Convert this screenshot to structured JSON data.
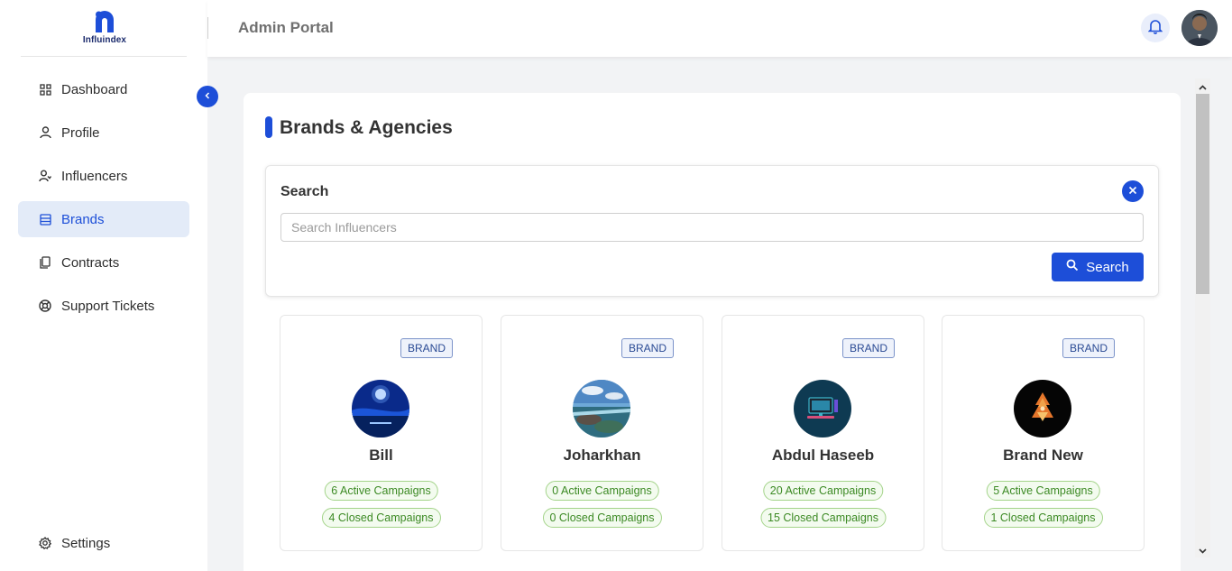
{
  "brand": {
    "logo_text": "Influindex"
  },
  "colors": {
    "accent": "#1d4ed8",
    "active_bg": "#e3ebf8",
    "pill_green": "#3c8a24"
  },
  "topbar": {
    "title": "Admin Portal",
    "bell_icon": "bell-icon"
  },
  "sidebar": {
    "items": [
      {
        "label": "Dashboard",
        "icon": "grid-icon"
      },
      {
        "label": "Profile",
        "icon": "user-icon"
      },
      {
        "label": "Influencers",
        "icon": "user-group-icon"
      },
      {
        "label": "Brands",
        "icon": "store-icon",
        "active": true
      },
      {
        "label": "Contracts",
        "icon": "document-icon"
      },
      {
        "label": "Support Tickets",
        "icon": "support-icon"
      }
    ],
    "settings": {
      "label": "Settings",
      "icon": "gear-icon"
    }
  },
  "page": {
    "heading": "Brands & Agencies"
  },
  "search": {
    "label": "Search",
    "placeholder": "Search Influencers",
    "value": "",
    "button_label": "Search"
  },
  "cards": [
    {
      "badge": "BRAND",
      "name": "Bill",
      "active": "6 Active Campaigns",
      "closed": "4 Closed Campaigns"
    },
    {
      "badge": "BRAND",
      "name": "Joharkhan",
      "active": "0 Active Campaigns",
      "closed": "0 Closed Campaigns"
    },
    {
      "badge": "BRAND",
      "name": "Abdul Haseeb",
      "active": "20 Active Campaigns",
      "closed": "15 Closed Campaigns"
    },
    {
      "badge": "BRAND",
      "name": "Brand New",
      "active": "5 Active Campaigns",
      "closed": "1 Closed Campaigns"
    }
  ]
}
